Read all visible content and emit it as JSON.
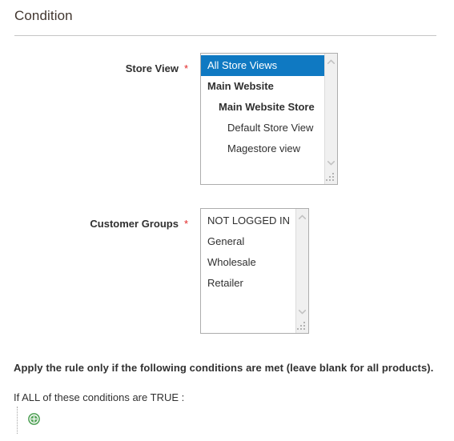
{
  "section": {
    "title": "Condition"
  },
  "fields": {
    "store_view": {
      "label": "Store View",
      "required_mark": "*",
      "options": [
        {
          "label": "All Store Views",
          "level": 0,
          "selected": true
        },
        {
          "label": "Main Website",
          "level": 1,
          "selected": false
        },
        {
          "label": "Main Website Store",
          "level": 2,
          "selected": false
        },
        {
          "label": "Default Store View",
          "level": 3,
          "selected": false
        },
        {
          "label": "Magestore view",
          "level": 3,
          "selected": false
        }
      ]
    },
    "customer_groups": {
      "label": "Customer Groups",
      "required_mark": "*",
      "options": [
        {
          "label": "NOT LOGGED IN",
          "level": 0,
          "selected": false
        },
        {
          "label": "General",
          "level": 0,
          "selected": false
        },
        {
          "label": "Wholesale",
          "level": 0,
          "selected": false
        },
        {
          "label": "Retailer",
          "level": 0,
          "selected": false
        }
      ]
    }
  },
  "conditions": {
    "note": "Apply the rule only if the following conditions are met (leave blank for all products).",
    "prefix": "If",
    "aggregator": "ALL",
    "middle": "of these conditions are",
    "value": "TRUE",
    "suffix": ":",
    "add_icon": "plus-circle-icon"
  },
  "colors": {
    "selection_blue": "#0f79c2",
    "required_red": "#e22626",
    "add_green": "#44a047",
    "text": "#303030",
    "title": "#41362f",
    "border": "#adadad",
    "divider": "#c6c6c6",
    "scrollbar_track": "#f0f0f0"
  }
}
